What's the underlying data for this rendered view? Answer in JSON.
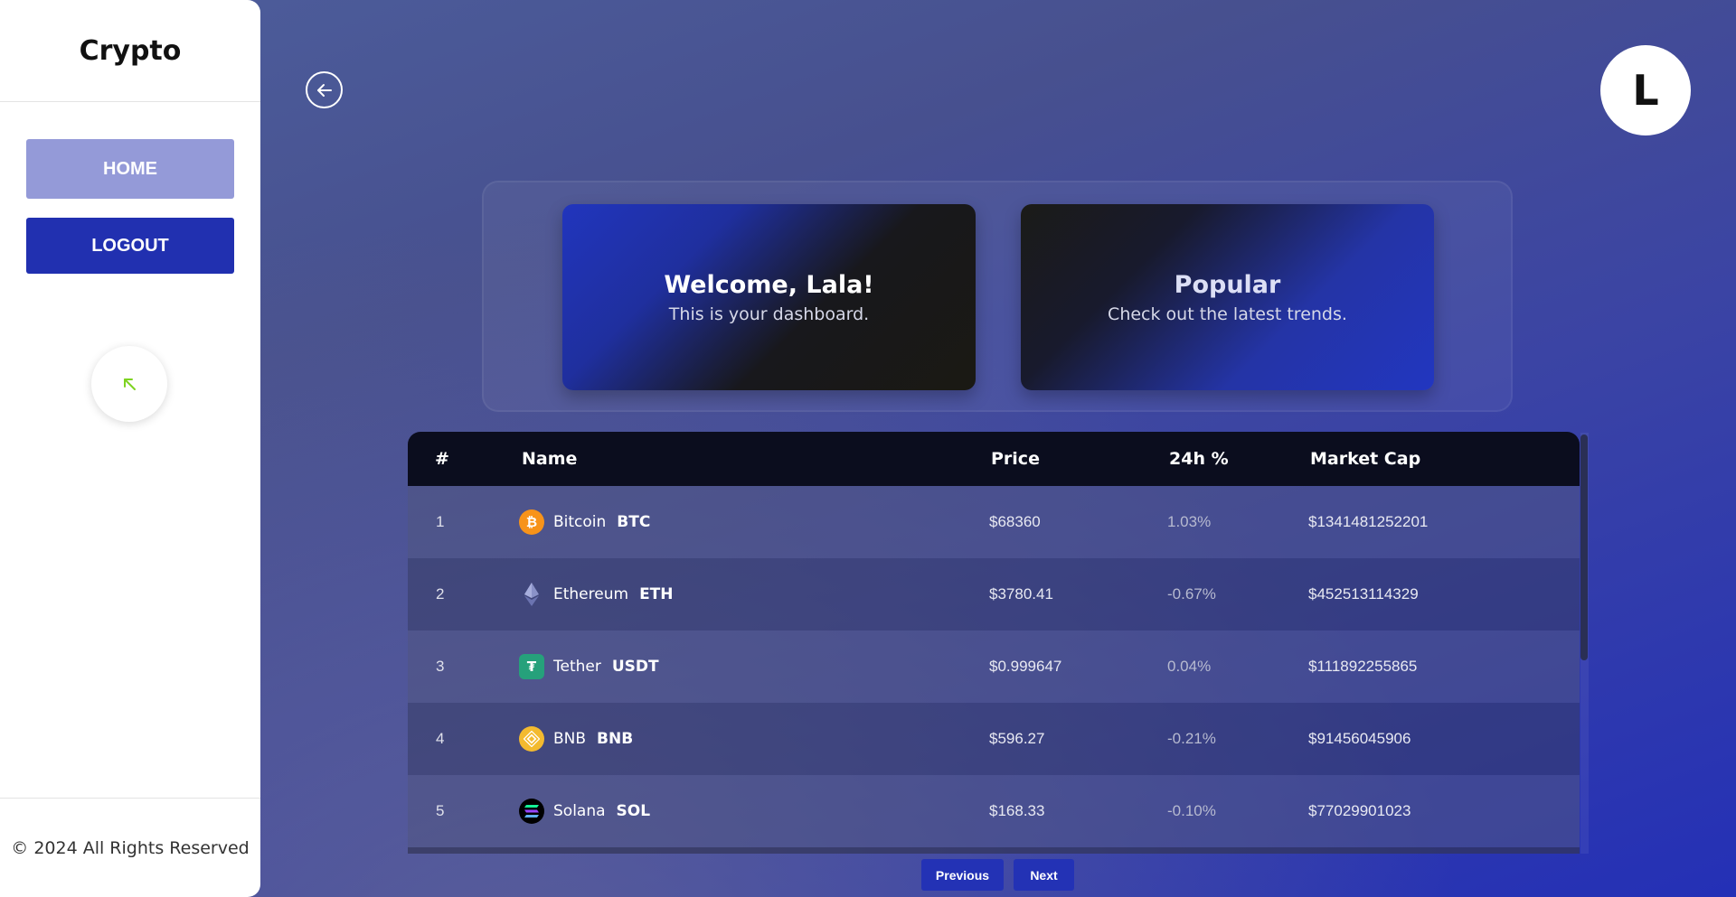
{
  "sidebar": {
    "brand": "Crypto",
    "home_label": "HOME",
    "logout_label": "LOGOUT",
    "scroll_icon": "arrow-up-left-icon",
    "footer": "© 2024 All Rights Reserved"
  },
  "header": {
    "back_icon": "arrow-left-circle-icon",
    "avatar_initial": "L"
  },
  "cards": {
    "welcome": {
      "title": "Welcome, Lala!",
      "subtitle": "This is your dashboard."
    },
    "popular": {
      "title": "Popular",
      "subtitle": "Check out the latest trends."
    }
  },
  "table": {
    "headers": {
      "rank": "#",
      "name": "Name",
      "price": "Price",
      "change": "24h %",
      "cap": "Market Cap"
    },
    "rows": [
      {
        "rank": "1",
        "name": "Bitcoin",
        "symbol": "BTC",
        "price": "$68360",
        "change": "1.03%",
        "cap": "$1341481252201",
        "icon": "bitcoin-icon",
        "icon_color": "#f7931a"
      },
      {
        "rank": "2",
        "name": "Ethereum",
        "symbol": "ETH",
        "price": "$3780.41",
        "change": "-0.67%",
        "cap": "$452513114329",
        "icon": "ethereum-icon",
        "icon_color": "#627eea"
      },
      {
        "rank": "3",
        "name": "Tether",
        "symbol": "USDT",
        "price": "$0.999647",
        "change": "0.04%",
        "cap": "$111892255865",
        "icon": "tether-icon",
        "icon_color": "#26a17b"
      },
      {
        "rank": "4",
        "name": "BNB",
        "symbol": "BNB",
        "price": "$596.27",
        "change": "-0.21%",
        "cap": "$91456045906",
        "icon": "bnb-icon",
        "icon_color": "#f3ba2f"
      },
      {
        "rank": "5",
        "name": "Solana",
        "symbol": "SOL",
        "price": "$168.33",
        "change": "-0.10%",
        "cap": "$77029901023",
        "icon": "solana-icon",
        "icon_color": "#14f195"
      }
    ]
  },
  "pagination": {
    "previous": "Previous",
    "next": "Next"
  },
  "colors": {
    "accent": "#2130b0",
    "home_button": "#949ad8",
    "table_header": "#0b0d1e"
  }
}
